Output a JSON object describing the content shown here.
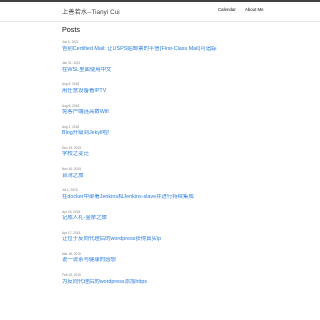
{
  "header": {
    "site_title": "上善若水--Tianyi Cui",
    "nav": [
      "Calendar",
      "About Me"
    ]
  },
  "main": {
    "section_title": "Posts",
    "posts": [
      {
        "date": "Jun 6, 2021",
        "title": "告别Certified Mail: 让USPS贴邮票的平信(First-Class Mail)可追踪"
      },
      {
        "date": "Jan 31, 2021",
        "title": "在WSL里面使用中文"
      },
      {
        "date": "Aug 9, 2018",
        "title": "用任意设备看IPTV"
      },
      {
        "date": "Aug 8, 2018",
        "title": "免客户端连高数Wifi"
      },
      {
        "date": "Aug 1, 2018",
        "title": "Blog升级到Jekyll啦!"
      },
      {
        "date": "Dec 19, 2015",
        "title": "学校之变迁"
      },
      {
        "date": "Nov 16, 2015",
        "title": "台湾之旅"
      },
      {
        "date": "Jul 1, 2015",
        "title": "在docker中部署Jenkins和Jenkins-slave并进行持续集成"
      },
      {
        "date": "Apr 18, 2015",
        "title": "记成人礼-金摩之旅"
      },
      {
        "date": "Apr 17, 2015",
        "title": "让位于反向代理后的wordpress获得真实ip"
      },
      {
        "date": "Mar 18, 2015",
        "title": "说一说茶与健康的感想"
      },
      {
        "date": "Feb 19, 2015",
        "title": "为反向代理后的wordpress添加https"
      }
    ]
  }
}
